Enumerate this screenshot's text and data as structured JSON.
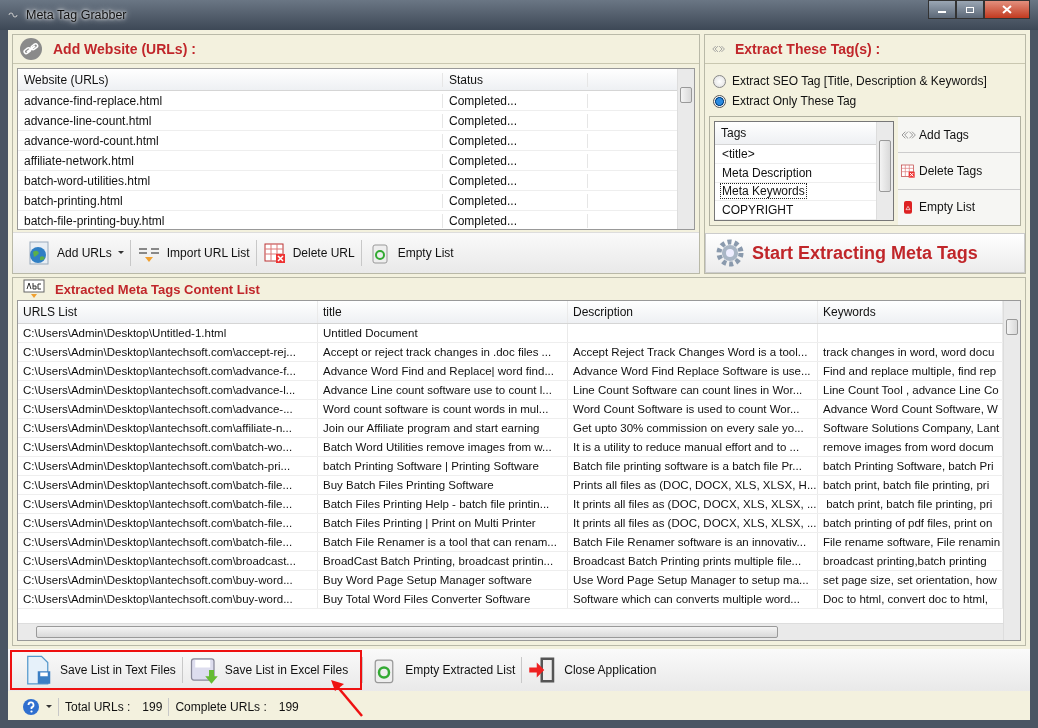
{
  "window": {
    "title": "Meta Tag Grabber"
  },
  "add_website": {
    "heading": "Add Website (URLs) :",
    "columns": [
      "Website (URLs)",
      "Status"
    ],
    "rows": [
      {
        "url": "advance-find-replace.html",
        "status": "Completed..."
      },
      {
        "url": "advance-line-count.html",
        "status": "Completed..."
      },
      {
        "url": "advance-word-count.html",
        "status": "Completed..."
      },
      {
        "url": "affiliate-network.html",
        "status": "Completed..."
      },
      {
        "url": "batch-word-utilities.html",
        "status": "Completed..."
      },
      {
        "url": "batch-printing.html",
        "status": "Completed..."
      },
      {
        "url": "batch-file-printing-buy.html",
        "status": "Completed..."
      }
    ]
  },
  "url_toolbar": [
    {
      "kind": "globe",
      "label": "Add URLs",
      "dropdown": true
    },
    {
      "kind": "import",
      "label": "Import URL List",
      "dropdown": false
    },
    {
      "kind": "delete",
      "label": "Delete URL",
      "dropdown": false
    },
    {
      "kind": "recycle",
      "label": "Empty List",
      "dropdown": false
    }
  ],
  "extract_tags": {
    "heading": "Extract These Tag(s) :",
    "options": [
      {
        "label": "Extract SEO Tag [Title, Description & Keywords]",
        "selected": false
      },
      {
        "label": "Extract Only These Tag",
        "selected": true
      }
    ],
    "tags_column": "Tags",
    "tags": [
      {
        "label": "<title>",
        "focused": false
      },
      {
        "label": "Meta Description",
        "focused": false
      },
      {
        "label": "Meta Keywords",
        "focused": true
      },
      {
        "label": "COPYRIGHT",
        "focused": false
      }
    ],
    "actions": [
      {
        "kind": "arrows",
        "label": "Add Tags"
      },
      {
        "kind": "delete",
        "label": "Delete Tags"
      },
      {
        "kind": "bin",
        "label": "Empty List"
      }
    ]
  },
  "start_button": "Start Extracting Meta Tags",
  "extracted": {
    "heading": "Extracted Meta Tags Content List",
    "columns": [
      "URLS List",
      "title",
      "Description",
      "Keywords"
    ],
    "rows": [
      {
        "url": "C:\\Users\\Admin\\Desktop\\Untitled-1.html",
        "title": "Untitled Document"
      },
      {
        "url": "C:\\Users\\Admin\\Desktop\\lantechsoft.com\\accept-rej...",
        "title": "Accept or reject track changes in .doc files ...",
        "description": "Accept Reject Track Changes Word is a tool...",
        "keywords": "track changes in word, word docu"
      },
      {
        "url": "C:\\Users\\Admin\\Desktop\\lantechsoft.com\\advance-f...",
        "title": "Advance Word Find and Replace| word find...",
        "description": "Advance Word Find Replace Software is use...",
        "keywords": "Find and replace multiple, find rep"
      },
      {
        "url": "C:\\Users\\Admin\\Desktop\\lantechsoft.com\\advance-l...",
        "title": "Advance Line count software use to count l...",
        "description": "Line Count Software can count lines in Wor...",
        "keywords": "Line Count Tool , advance Line Co"
      },
      {
        "url": "C:\\Users\\Admin\\Desktop\\lantechsoft.com\\advance-...",
        "title": "Word count software is count words in mul...",
        "description": "Word Count Software is used to count Wor...",
        "keywords": "Advance Word Count Software, W"
      },
      {
        "url": "C:\\Users\\Admin\\Desktop\\lantechsoft.com\\affiliate-n...",
        "title": "Join our Affiliate program and start earning",
        "description": "Get upto 30% commission on every sale yo...",
        "keywords": "Software Solutions Company, Lant"
      },
      {
        "url": "C:\\Users\\Admin\\Desktop\\lantechsoft.com\\batch-wo...",
        "title": "Batch Word Utilities remove images from w...",
        "description": "It is a utility to reduce manual effort and to ...",
        "keywords": "remove images from word docum"
      },
      {
        "url": "C:\\Users\\Admin\\Desktop\\lantechsoft.com\\batch-pri...",
        "title": "batch Printing Software | Printing Software",
        "description": "Batch file printing software is a batch file Pr...",
        "keywords": "batch Printing Software, batch Pri"
      },
      {
        "url": "C:\\Users\\Admin\\Desktop\\lantechsoft.com\\batch-file...",
        "title": "Buy Batch Files Printing Software",
        "description": "Prints all files as (DOC, DOCX, XLS, XLSX, H...",
        "keywords": "batch print, batch file printing, pri"
      },
      {
        "url": "C:\\Users\\Admin\\Desktop\\lantechsoft.com\\batch-file...",
        "title": "Batch Files Printing Help - batch file printin...",
        "description": "It prints all files as (DOC, DOCX, XLS, XLSX, ...",
        "keywords": " batch print, batch file printing, pri"
      },
      {
        "url": "C:\\Users\\Admin\\Desktop\\lantechsoft.com\\batch-file...",
        "title": "Batch Files Printing | Print on Multi Printer",
        "description": "It prints all files as (DOC, DOCX, XLS, XLSX, ...",
        "keywords": "batch printing of pdf files, print on"
      },
      {
        "url": "C:\\Users\\Admin\\Desktop\\lantechsoft.com\\batch-file...",
        "title": "Batch File Renamer is a tool that can renam...",
        "description": "Batch File Renamer software is an innovativ...",
        "keywords": "File rename software, File renamin"
      },
      {
        "url": "C:\\Users\\Admin\\Desktop\\lantechsoft.com\\broadcast...",
        "title": "BroadCast Batch Printing, broadcast printin...",
        "description": "Broadcast Batch Printing prints multiple file...",
        "keywords": "broadcast printing,batch printing"
      },
      {
        "url": "C:\\Users\\Admin\\Desktop\\lantechsoft.com\\buy-word...",
        "title": "Buy Word Page Setup Manager software",
        "description": "Use Word Page Setup Manager to setup ma...",
        "keywords": "set page size, set orientation, how"
      },
      {
        "url": "C:\\Users\\Admin\\Desktop\\lantechsoft.com\\buy-word...",
        "title": "Buy Total Word Files Converter Software",
        "description": "Software which can converts multiple word...",
        "keywords": "Doc to html, convert doc to html,"
      }
    ]
  },
  "bottom_toolbar": [
    {
      "kind": "text-file",
      "label": "Save List in Text Files"
    },
    {
      "kind": "excel-file",
      "label": "Save List in Excel Files"
    },
    {
      "kind": "recycle",
      "label": "Empty Extracted List"
    },
    {
      "kind": "exit",
      "label": "Close Application"
    }
  ],
  "status_bar": {
    "total_label": "Total URLs :",
    "total": "199",
    "complete_label": "Complete URLs :",
    "complete": "199"
  }
}
